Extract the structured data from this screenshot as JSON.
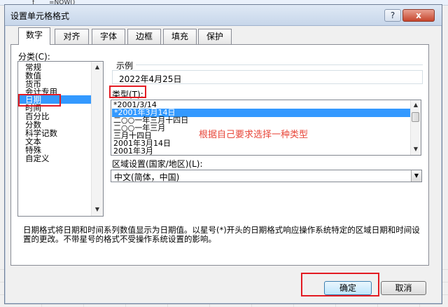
{
  "background": {
    "fx_label": "f",
    "formula": "=NOW()"
  },
  "window": {
    "title": "设置单元格格式",
    "help": "?",
    "close": "x"
  },
  "tabs": [
    {
      "label": "数字",
      "active": true
    },
    {
      "label": "对齐"
    },
    {
      "label": "字体"
    },
    {
      "label": "边框"
    },
    {
      "label": "填充"
    },
    {
      "label": "保护"
    }
  ],
  "category": {
    "label": "分类(C):",
    "items": [
      "常规",
      "数值",
      "货币",
      "会计专用",
      "日期",
      "时间",
      "百分比",
      "分数",
      "科学记数",
      "文本",
      "特殊",
      "自定义"
    ],
    "selected_index": 4
  },
  "sample": {
    "label": "示例",
    "value": "2022年4月25日"
  },
  "type": {
    "label": "类型(T):",
    "items": [
      "*2001/3/14",
      "*2001年3月14日",
      "二○○一年三月十四日",
      "二○○一年三月",
      "三月十四日",
      "2001年3月14日",
      "2001年3月"
    ],
    "selected_index": 1
  },
  "annotation": "根据自己要求选择一种类型",
  "locale": {
    "label": "区域设置(国家/地区)(L):",
    "value": "中文(简体，中国)"
  },
  "description": "日期格式将日期和时间系列数值显示为日期值。以星号(*)开头的日期格式响应操作系统特定的区域日期和时间设置的更改。不带星号的格式不受操作系统设置的影响。",
  "buttons": {
    "ok": "确定",
    "cancel": "取消"
  },
  "colors": {
    "selection": "#3399ff",
    "highlight": "#e31b23",
    "annotation": "#e8473a"
  }
}
